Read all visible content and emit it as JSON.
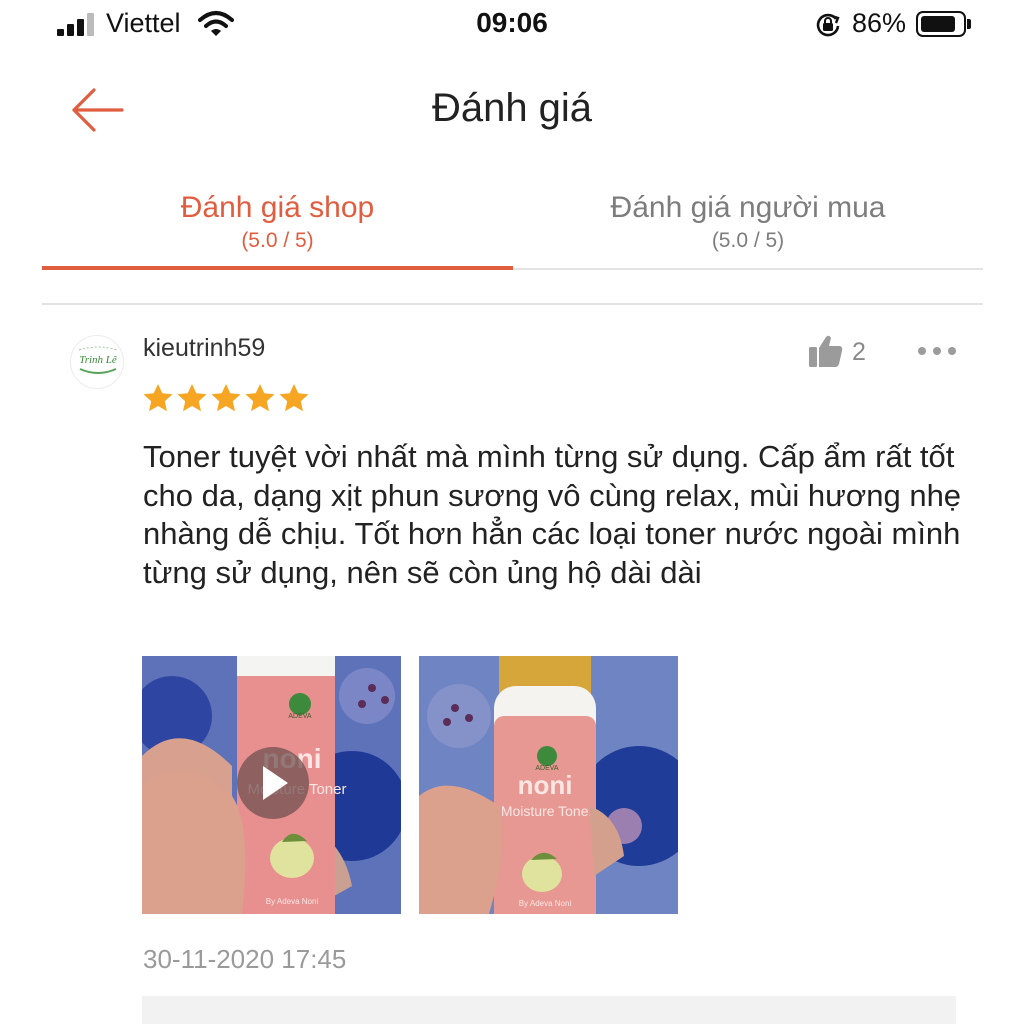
{
  "status_bar": {
    "carrier": "Viettel",
    "time": "09:06",
    "battery_percent": "86%",
    "battery_level": 0.86,
    "icons": [
      "signal-icon",
      "wifi-icon",
      "rotation-lock-icon",
      "battery-icon"
    ]
  },
  "header": {
    "title": "Đánh giá",
    "back_icon": "arrow-left-icon"
  },
  "tabs": [
    {
      "label": "Đánh giá shop",
      "score": "(5.0 / 5)",
      "active": true
    },
    {
      "label": "Đánh giá người mua",
      "score": "(5.0 / 5)",
      "active": false
    }
  ],
  "review": {
    "avatar_text": "Trinh Lê",
    "username": "kieutrinh59",
    "likes": "2",
    "rating": 5,
    "text": "Toner tuyệt vời nhất mà mình từng sử dụng. Cấp ẩm rất tốt cho da, dạng xịt phun sương vô cùng relax, mùi hương nhẹ nhàng dễ chịu. Tốt hơn hẳn các loại toner nước ngoài mình từng sử dụng, nên sẽ còn ủng hộ dài dài",
    "media": [
      {
        "type": "video",
        "label_product": "noni",
        "label_sub": "Moisture Toner",
        "label_brand": "ADEVA",
        "label_by": "By Adeva Noni"
      },
      {
        "type": "image",
        "label_product": "noni",
        "label_sub": "Moisture Toner",
        "label_brand": "ADEVA",
        "label_by": "By Adeva Noni"
      }
    ],
    "date": "30-11-2020 17:45"
  },
  "colors": {
    "accent": "#e05d3f",
    "star": "#f6a623",
    "muted": "#8a8a8a"
  }
}
